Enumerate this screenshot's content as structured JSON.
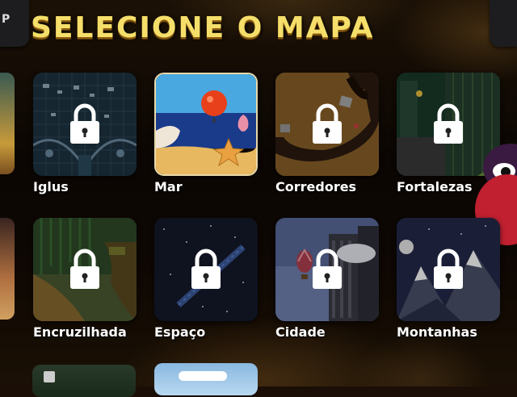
{
  "screen": {
    "title": "SELECIONE O MAPA"
  },
  "corner_left": {
    "glyph": "P"
  },
  "maps": [
    {
      "name": "Iglus",
      "locked": true
    },
    {
      "name": "Mar",
      "locked": false
    },
    {
      "name": "Corredores",
      "locked": true
    },
    {
      "name": "Fortalezas",
      "locked": true
    },
    {
      "name": "Encruzilhada",
      "locked": true
    },
    {
      "name": "Espaço",
      "locked": true
    },
    {
      "name": "Cidade",
      "locked": true
    },
    {
      "name": "Montanhas",
      "locked": true
    }
  ],
  "colors": {
    "title": "#f5df6a",
    "lock": "#ffffff",
    "label": "#ffffff"
  }
}
